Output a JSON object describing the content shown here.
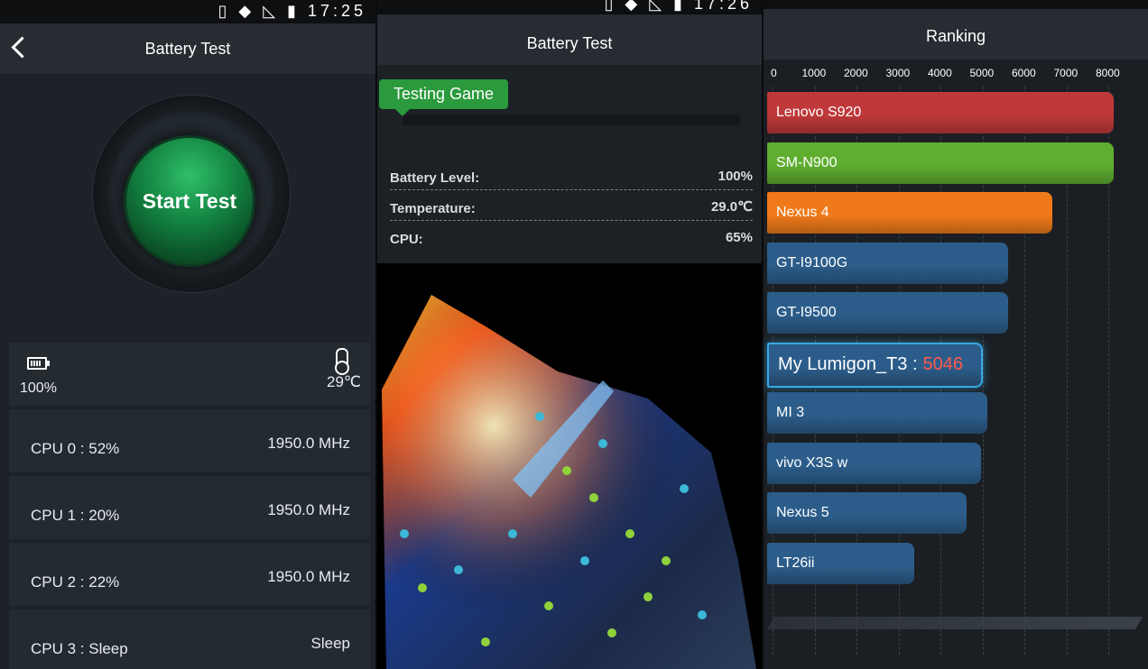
{
  "left": {
    "status_time": "17:25",
    "title": "Battery Test",
    "start_label": "Start Test",
    "battery_value": "100%",
    "temperature_value": "29℃",
    "cpus": [
      {
        "name": "CPU 0 : 52%",
        "freq": "1950.0 MHz"
      },
      {
        "name": "CPU 1 : 20%",
        "freq": "1950.0 MHz"
      },
      {
        "name": "CPU 2 : 22%",
        "freq": "1950.0 MHz"
      },
      {
        "name": "CPU 3 : Sleep",
        "freq": "Sleep"
      }
    ]
  },
  "middle": {
    "status_time": "17:26",
    "title": "Battery Test",
    "game_tag": "Testing Game",
    "battery_label": "Battery Level:",
    "battery_value": "100%",
    "temp_label": "Temperature:",
    "temp_value": "29.0℃",
    "cpu_label": "CPU:",
    "cpu_value": "65%"
  },
  "right": {
    "title": "Ranking",
    "ticks": [
      "0",
      "1000",
      "2000",
      "3000",
      "4000",
      "5000",
      "6000",
      "7000",
      "8000"
    ],
    "my_device_label": "My Lumigon_T3 :",
    "my_device_score": "5046"
  },
  "chart_data": {
    "type": "bar",
    "orientation": "horizontal",
    "title": "Ranking",
    "xlim": [
      0,
      9000
    ],
    "categories": [
      "Lenovo S920",
      "SM-N900",
      "Nexus 4",
      "GT-I9100G",
      "GT-I9500",
      "My Lumigon_T3",
      "MI 3",
      "vivo X3S w",
      "Nexus 5",
      "LT26ii"
    ],
    "values": [
      8250,
      8250,
      6800,
      5750,
      5750,
      5046,
      5250,
      5100,
      4750,
      3500
    ],
    "colors": [
      "#c0393a",
      "#5fae30",
      "#f07a1a",
      "#2c5d8a",
      "#2c5d8a",
      "#2c5d8a",
      "#2c5d8a",
      "#2c5d8a",
      "#2c5d8a",
      "#2c5d8a"
    ]
  }
}
